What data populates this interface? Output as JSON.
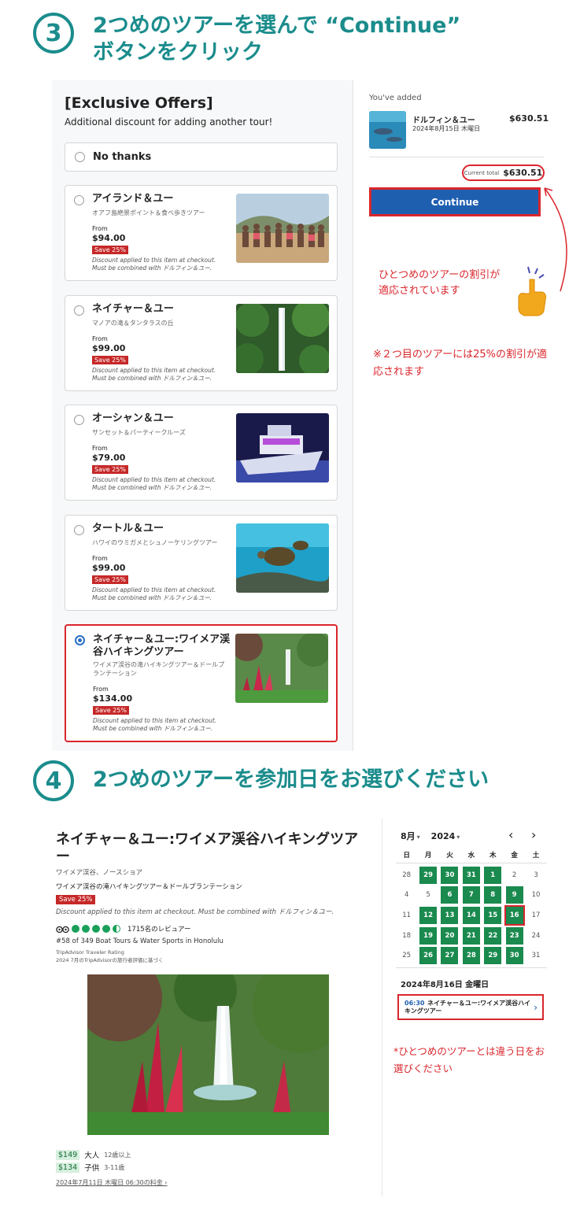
{
  "step3": {
    "num": "3",
    "title_line1": "2つめのツアーを選んで “Continue”",
    "title_line2": "ボタンをクリック"
  },
  "offers": {
    "title": "[Exclusive Offers]",
    "subtitle": "Additional discount for adding another tour!",
    "no_thanks": "No thanks",
    "cards": [
      {
        "name": "アイランド＆ユー",
        "desc": "オアフ島絶景ポイント＆食べ歩きツアー",
        "from": "From",
        "price": "$94.00",
        "save": "Save 25%",
        "disc1": "Discount applied to this item at checkout.",
        "disc2": "Must be combined with ドルフィン＆ユー."
      },
      {
        "name": "ネイチャー＆ユー",
        "desc": "マノアの滝＆タンタラスの丘",
        "from": "From",
        "price": "$99.00",
        "save": "Save 25%",
        "disc1": "Discount applied to this item at checkout.",
        "disc2": "Must be combined with ドルフィン＆ユー."
      },
      {
        "name": "オーシャン＆ユー",
        "desc": "サンセット＆パーティークルーズ",
        "from": "From",
        "price": "$79.00",
        "save": "Save 25%",
        "disc1": "Discount applied to this item at checkout.",
        "disc2": "Must be combined with ドルフィン＆ユー."
      },
      {
        "name": "タートル＆ユー",
        "desc": "ハワイのウミガメとシュノーケリングツアー",
        "from": "From",
        "price": "$99.00",
        "save": "Save 25%",
        "disc1": "Discount applied to this item at checkout.",
        "disc2": "Must be combined with ドルフィン＆ユー."
      },
      {
        "name": "ネイチャー＆ユー:ワイメア渓谷ハイキングツアー",
        "desc": "ワイメア渓谷の滝ハイキングツアー＆ドールプランテーション",
        "from": "From",
        "price": "$134.00",
        "save": "Save 25%",
        "disc1": "Discount applied to this item at checkout.",
        "disc2": "Must be combined with ドルフィン＆ユー."
      }
    ]
  },
  "cart": {
    "added_label": "You've added",
    "item_name": "ドルフィン＆ユー",
    "item_date": "2024年8月15日 木曜日",
    "item_price": "$630.51",
    "total_label": "Current total",
    "total_value": "$630.51",
    "continue_label": "Continue"
  },
  "notes": {
    "note1": "ひとつめのツアーの割引が適応されています",
    "note2": "※２つ目のツアーには25%の割引が適応されます",
    "note3": "*ひとつめのツアーとは違う日をお選びください"
  },
  "step4": {
    "num": "4",
    "title": "2つめのツアーを参加日をお選びください"
  },
  "tour": {
    "title": "ネイチャー＆ユー:ワイメア渓谷ハイキングツアー",
    "location": "ワイメア渓谷、ノースショア",
    "desc": "ワイメア渓谷の滝ハイキングツアー＆ドールプランテーション",
    "save": "Save 25%",
    "disc": "Discount applied to this item at checkout. Must be combined with ドルフィン＆ユー.",
    "reviews": "1715名のレビュアー",
    "rank": "#58 of 349 Boat Tours & Water Sports in Honolulu",
    "ta1": "TripAdvisor Traveler Rating",
    "ta2": "2024 7月のTripAdvisorの旅行者評価に基づく",
    "prices": [
      {
        "amount": "$149",
        "who": "大人",
        "age": "12歳以上"
      },
      {
        "amount": "$134",
        "who": "子供",
        "age": "3-11歳"
      }
    ],
    "last": "2024年7月11日 木曜日 06:30の料金 ›"
  },
  "calendar": {
    "month": "8月",
    "year": "2024",
    "prev": "‹",
    "next": "›",
    "weekdays": [
      "日",
      "月",
      "火",
      "水",
      "木",
      "金",
      "土"
    ],
    "weeks": [
      [
        "28",
        "29",
        "30",
        "31",
        "1",
        "2",
        "3"
      ],
      [
        "4",
        "5",
        "6",
        "7",
        "8",
        "9",
        "10"
      ],
      [
        "11",
        "12",
        "13",
        "14",
        "15",
        "16",
        "17"
      ],
      [
        "18",
        "19",
        "20",
        "21",
        "22",
        "23",
        "24"
      ],
      [
        "25",
        "26",
        "27",
        "28",
        "29",
        "30",
        "31"
      ]
    ],
    "selected_date": "2024年8月16日 金曜日",
    "slot_time": "06:30",
    "slot_name": "ネイチャー＆ユー:ワイメア渓谷ハイキングツアー"
  }
}
